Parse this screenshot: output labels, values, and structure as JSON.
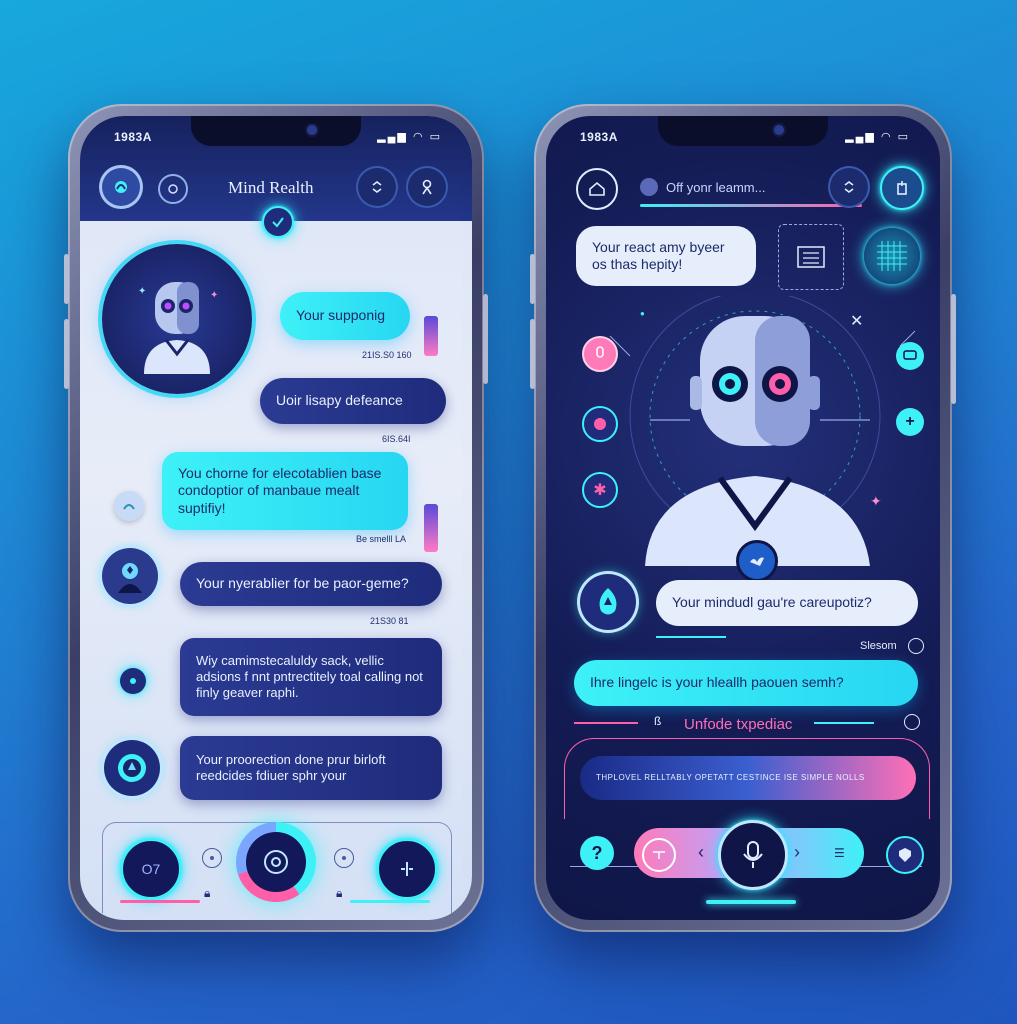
{
  "left": {
    "status_time": "1983A",
    "status_icons": "▂▄▆ ◠ ▭",
    "title": "Mind Realth",
    "messages": [
      {
        "text": "Your supponig",
        "time": "21IS.S0 160"
      },
      {
        "text": "Uoir lisapy defeance",
        "time": "6IS.64I"
      },
      {
        "text": "You chorne for elecotablien base condoptior of manbaue mealt suptifiy!",
        "time": "Be smelll LA"
      },
      {
        "text": "Your nyerablier for be paor-geme?",
        "time": "21S30 81"
      },
      {
        "text": "Wiy camimstecaluldy sack, vellic adsions f nnt pntrectitely toal calling not finly geaver raphi.",
        "time": ""
      },
      {
        "text": "Your proorection done prur birloft reedcides fdiuer sphr your",
        "time": ""
      }
    ],
    "bottom_left_label": "O7"
  },
  "right": {
    "status_time": "1983A",
    "status_icons": "▂▄▆ ◠ ▭",
    "search_placeholder": "Off yonr leamm...",
    "top_message": "Your react amy byeer os thas hepity!",
    "messages": [
      {
        "text": "Your mindudl gau're careupotiz?"
      },
      {
        "text": "Ihre lingelc is your hleallh paouen semh?"
      }
    ],
    "timestamp_label": "Slesom",
    "unfold_label": "Unfode txpediac",
    "banner_text": "THPLOVEL RELLTABLY OPETATT CESTINCE ISE SIMPLE NOLLS"
  },
  "colors": {
    "accent": "#3ef1f7",
    "navy": "#1f2c7c",
    "pink": "#ff5fa8"
  }
}
